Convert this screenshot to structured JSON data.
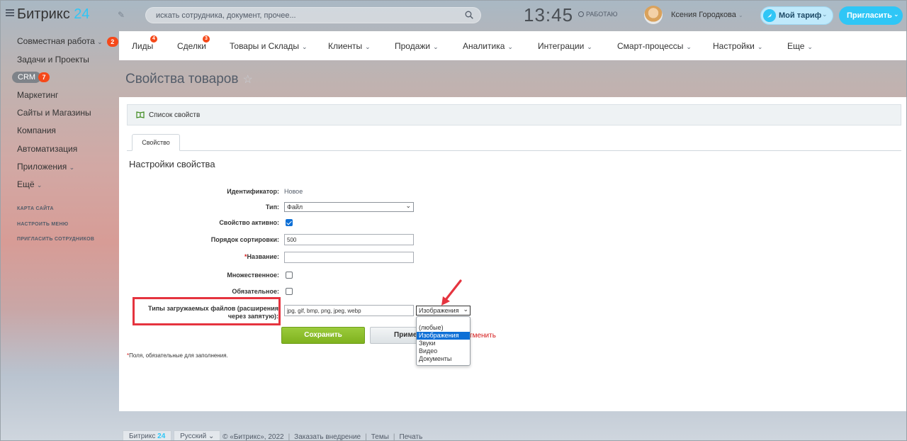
{
  "header": {
    "logo_text": "Битрикс",
    "logo_num": "24",
    "search_placeholder": "искать сотрудника, документ, прочее...",
    "clock": "13:45",
    "work_status": "РАБОТАЮ",
    "user_name": "Ксения Городкова",
    "tariff_label": "Мой тариф",
    "invite_label": "Пригласить"
  },
  "sidebar": {
    "items": [
      {
        "label": "Совместная работа",
        "badge": "2"
      },
      {
        "label": "Задачи и Проекты"
      },
      {
        "label": "CRM",
        "badge": "7"
      },
      {
        "label": "Маркетинг"
      },
      {
        "label": "Сайты и Магазины"
      },
      {
        "label": "Компания"
      },
      {
        "label": "Автоматизация"
      },
      {
        "label": "Приложения"
      },
      {
        "label": "Ещё"
      }
    ],
    "links": [
      "КАРТА САЙТА",
      "НАСТРОИТЬ МЕНЮ",
      "ПРИГЛАСИТЬ СОТРУДНИКОВ"
    ]
  },
  "nav": {
    "items": [
      {
        "label": "Лиды",
        "badge": "4"
      },
      {
        "label": "Сделки",
        "badge": "3"
      },
      {
        "label": "Товары и Склады"
      },
      {
        "label": "Клиенты"
      },
      {
        "label": "Продажи"
      },
      {
        "label": "Аналитика"
      },
      {
        "label": "Интеграции"
      },
      {
        "label": "Смарт-процессы"
      },
      {
        "label": "Настройки"
      },
      {
        "label": "Еще"
      }
    ]
  },
  "page": {
    "title": "Свойства товаров",
    "prop_list_link": "Список свойств",
    "tab_label": "Свойство",
    "section_title": "Настройки свойства"
  },
  "form": {
    "identifier_label": "Идентификатор:",
    "identifier_value": "Новое",
    "type_label": "Тип:",
    "type_value": "Файл",
    "active_label": "Свойство активно:",
    "active_checked": true,
    "sort_label": "Порядок сортировки:",
    "sort_value": "500",
    "name_req": "*",
    "name_label": "Название:",
    "name_value": "",
    "multiple_label": "Множественное:",
    "multiple_checked": false,
    "required_label": "Обязательное:",
    "required_checked": false,
    "filetypes_label": "Типы загружаемых файлов (расширения через запятую):",
    "filetypes_value": "jpg, gif, bmp, png, jpeg, webp",
    "filetypes_select": "Изображения",
    "filetypes_options": [
      "(любые)",
      "Изображения",
      "Звуки",
      "Видео",
      "Документы"
    ],
    "filetypes_selected_index": 1,
    "save_label": "Сохранить",
    "apply_label": "Применить",
    "cancel_label": "Отменить",
    "cancel_visible": "тменить",
    "req_note_star": "*",
    "req_note": "Поля, обязательные для заполнения."
  },
  "footer": {
    "logo_text": "Битрикс",
    "logo_num": "24",
    "language": "Русский",
    "copyright": "© «Битрикс», 2022",
    "order": "Заказать внедрение",
    "themes": "Темы",
    "print": "Печать"
  },
  "colors": {
    "accent": "#2fc6f6",
    "badge": "#f54819",
    "save_button": "#8cc02e",
    "highlight": "#e5343f",
    "required": "#d41a1a"
  }
}
